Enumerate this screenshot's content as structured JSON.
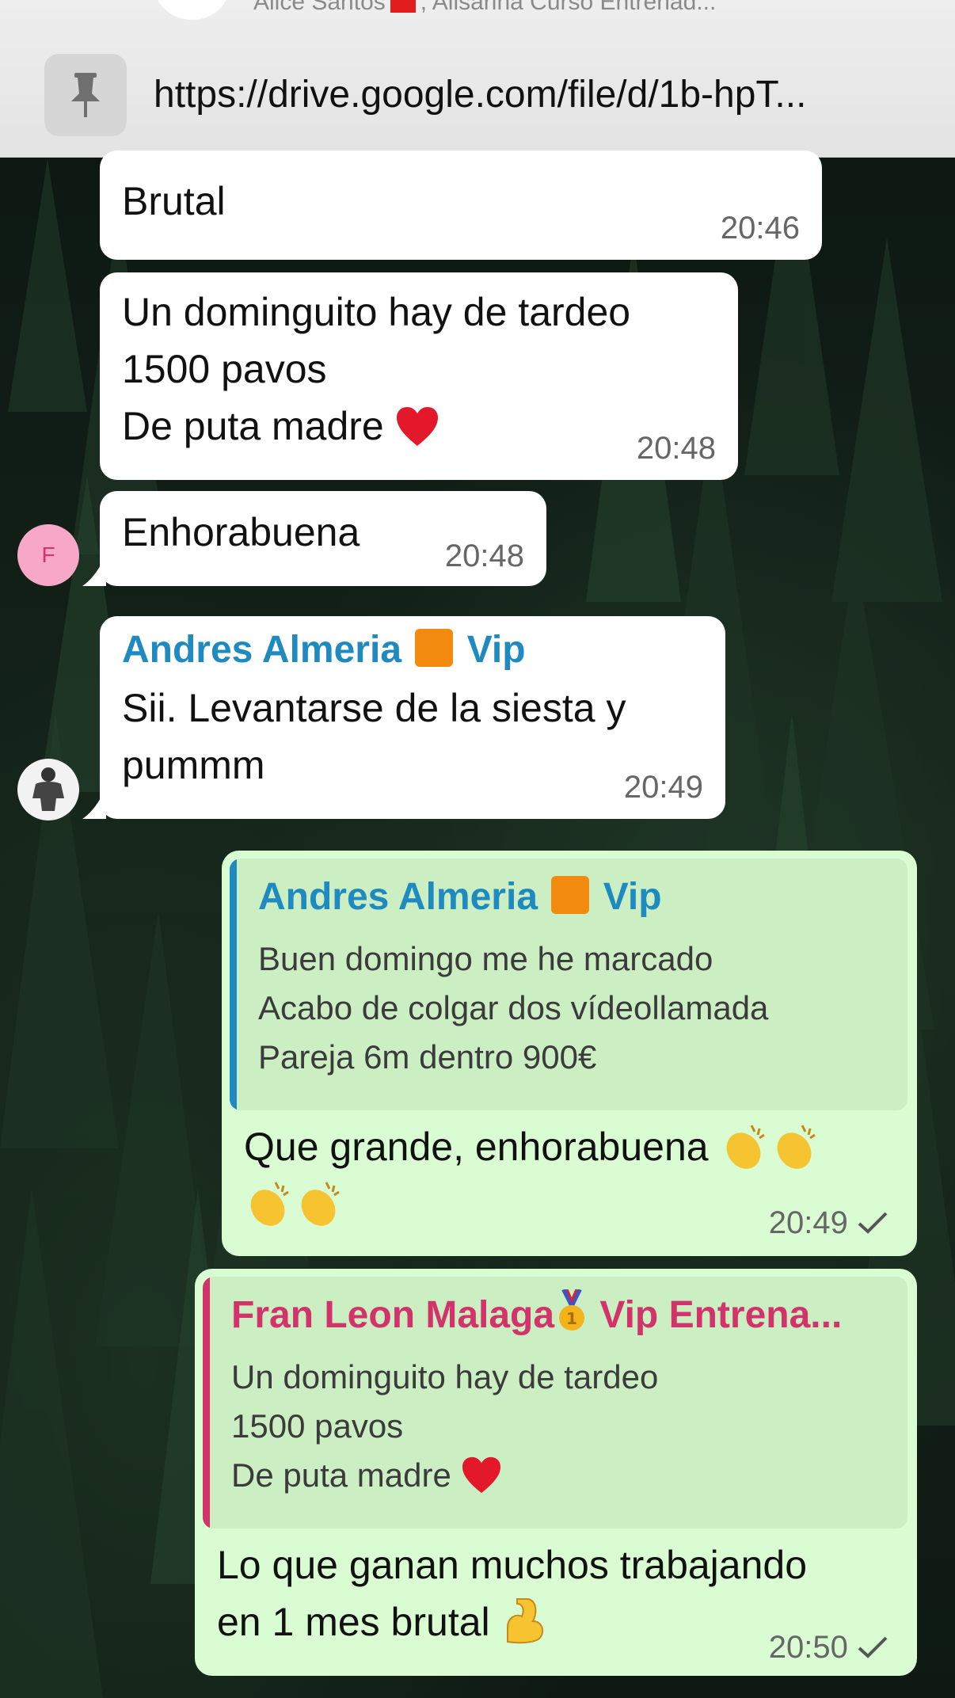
{
  "header": {
    "subtitle_name": "Alice Santos",
    "subtitle_rest": ", Alisarina Curso Entrenad...",
    "pinned_link": "https://drive.google.com/file/d/1b-hpT..."
  },
  "messages": [
    {
      "text": "Brutal",
      "time": "20:46"
    },
    {
      "lines": [
        "Un dominguito hay de tardeo",
        "1500 pavos",
        "De puta madre"
      ],
      "time": "20:48"
    },
    {
      "text": "Enhorabuena",
      "time": "20:48",
      "avatar_letter": "F"
    },
    {
      "sender": "Andres Almeria",
      "sender_tag": "Vip",
      "lines": [
        "Sii. Levantarse de  la siesta y",
        "pummm"
      ],
      "time": "20:49"
    },
    {
      "quote_sender": "Andres Almeria",
      "quote_tag": "Vip",
      "quote_lines": [
        "Buen domingo me he marcado",
        "Acabo de colgar dos vídeollamada",
        "Pareja 6m dentro 900€"
      ],
      "text": "Que grande, enhorabuena",
      "time": "20:49"
    },
    {
      "quote_sender": "Fran Leon Malaga",
      "quote_tag": "Vip Entrena...",
      "quote_lines": [
        "Un dominguito hay de tardeo",
        "1500 pavos",
        "De puta madre"
      ],
      "lines": [
        "Lo que ganan muchos trabajando",
        "en 1 mes brutal"
      ],
      "time": "20:50"
    }
  ],
  "colors": {
    "incoming": "#ffffff",
    "outgoing": "#dafcd2",
    "sender_blue": "#1f8ac0",
    "sender_pink": "#d2336a"
  },
  "icons": [
    "pin-icon",
    "heart-emoji",
    "clapping-hands-emoji",
    "flexed-biceps-emoji",
    "medal-emoji",
    "read-check-icon"
  ]
}
